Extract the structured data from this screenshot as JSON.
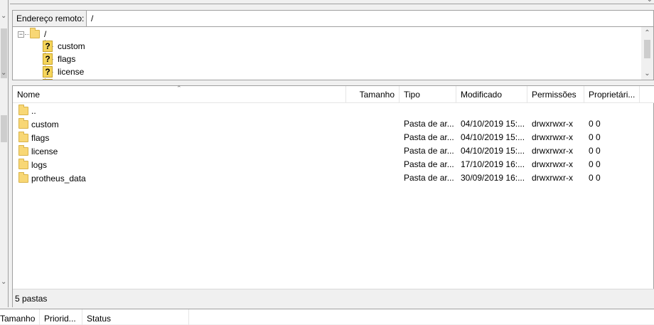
{
  "remote": {
    "address_label": "Endereço remoto:",
    "address_value": "/"
  },
  "tree": {
    "root": "/",
    "children": [
      "custom",
      "flags",
      "license"
    ]
  },
  "columns": {
    "name": "Nome",
    "size": "Tamanho",
    "type": "Tipo",
    "modified": "Modificado",
    "permissions": "Permissões",
    "owner": "Proprietári..."
  },
  "files": [
    {
      "name": "..",
      "type": "",
      "modified": "",
      "permissions": "",
      "owner": ""
    },
    {
      "name": "custom",
      "type": "Pasta de ar...",
      "modified": "04/10/2019 15:...",
      "permissions": "drwxrwxr-x",
      "owner": "0 0"
    },
    {
      "name": "flags",
      "type": "Pasta de ar...",
      "modified": "04/10/2019 15:...",
      "permissions": "drwxrwxr-x",
      "owner": "0 0"
    },
    {
      "name": "license",
      "type": "Pasta de ar...",
      "modified": "04/10/2019 15:...",
      "permissions": "drwxrwxr-x",
      "owner": "0 0"
    },
    {
      "name": "logs",
      "type": "Pasta de ar...",
      "modified": "17/10/2019 16:...",
      "permissions": "drwxrwxr-x",
      "owner": "0 0"
    },
    {
      "name": "protheus_data",
      "type": "Pasta de ar...",
      "modified": "30/09/2019 16:...",
      "permissions": "drwxrwxr-x",
      "owner": "0 0"
    }
  ],
  "status": "5 pastas",
  "queue": {
    "size": "Tamanho",
    "priority": "Priorid...",
    "status": "Status"
  },
  "icons": {
    "folder": "folder-icon",
    "unknown": "question-folder-icon",
    "collapse": "collapse-icon"
  },
  "colors": {
    "folder": "#f8d775",
    "unknown_folder": "#f5d55b"
  }
}
